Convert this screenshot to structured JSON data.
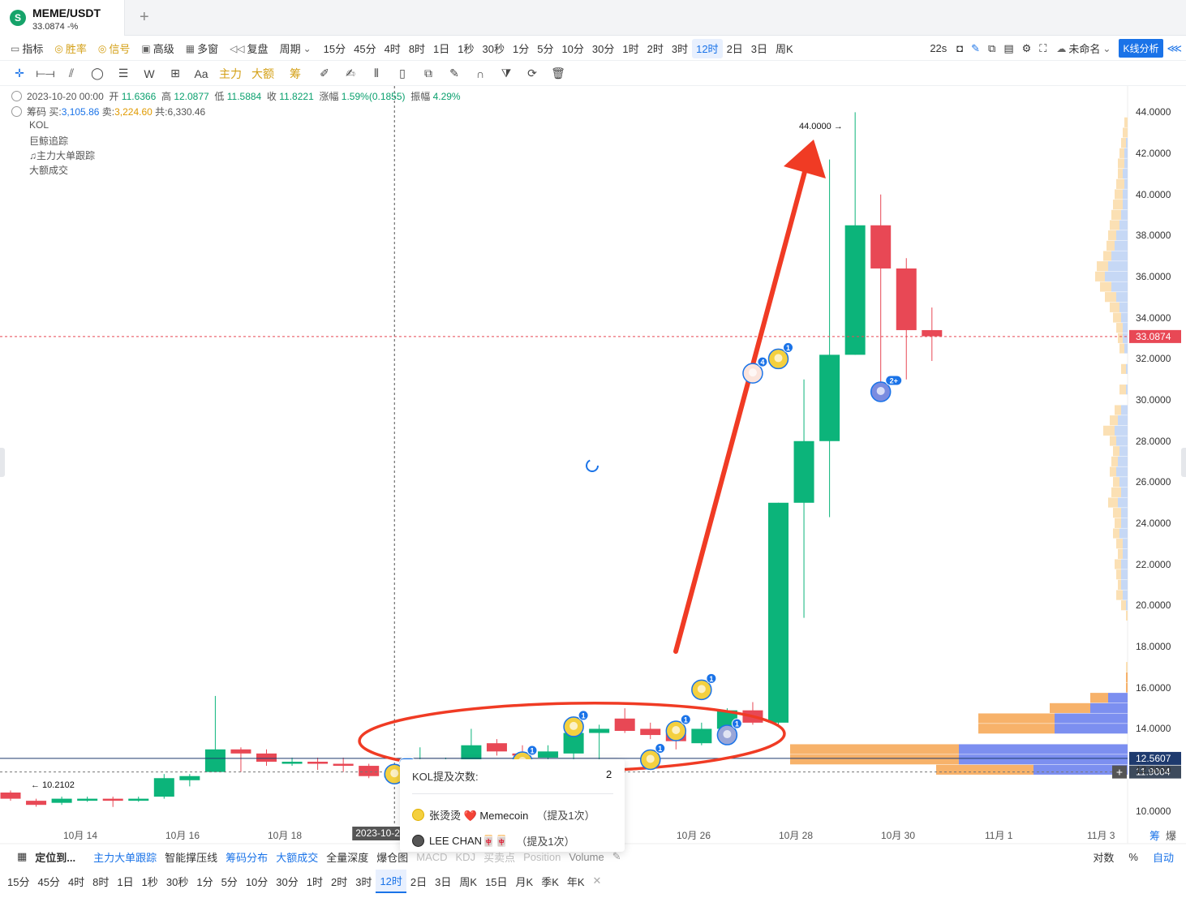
{
  "tab": {
    "title": "MEME/USDT",
    "subtitle": "33.0874  -%",
    "logo": "S"
  },
  "toolbar1": {
    "left": [
      {
        "label": "指标",
        "icon": "indicator-icon"
      },
      {
        "label": "胜率",
        "icon": "winrate-icon",
        "gold": true
      },
      {
        "label": "信号",
        "icon": "signal-icon",
        "gold": true
      },
      {
        "label": "高级",
        "icon": "advanced-icon"
      },
      {
        "label": "多窗",
        "icon": "multiwindow-icon"
      },
      {
        "label": "复盘",
        "icon": "replay-icon"
      },
      {
        "label": "周期",
        "icon": "chevron-down-icon"
      }
    ],
    "periods": [
      "15分",
      "45分",
      "4时",
      "8时",
      "1日",
      "1秒",
      "30秒",
      "1分",
      "5分",
      "10分",
      "30分",
      "1时",
      "2时",
      "3时",
      "12时",
      "2日",
      "3日",
      "周K"
    ],
    "active_period": "12时",
    "countdown": "22s",
    "layout_name": "未命名",
    "analysis_button": "K线分析"
  },
  "toolbar2": {
    "tools": [
      "crosshair-icon",
      "horizontal-line-icon",
      "trend-line-icon",
      "circle-icon",
      "parallel-lines-icon",
      "wave-icon",
      "box-icon",
      "text-icon"
    ],
    "text_tool": "Aa",
    "labels": [
      "主力",
      "大额",
      "筹"
    ],
    "tools_right": [
      "pen-icon",
      "brush-icon",
      "pattern-icon",
      "ruler-icon",
      "copy-icon",
      "note-icon",
      "magnet-icon",
      "filter-icon",
      "sync-icon",
      "trash-icon"
    ]
  },
  "info": {
    "date": "2023-10-20 00:00",
    "open_label": "开",
    "open": "11.6366",
    "high_label": "高",
    "high": "12.0877",
    "low_label": "低",
    "low": "11.5884",
    "close_label": "收",
    "close": "11.8221",
    "change_label": "涨幅",
    "change": "1.59%(0.1855)",
    "amplitude_label": "振幅",
    "amplitude": "4.29%",
    "chip_label": "筹码",
    "buy_label": "买:",
    "buy": "3,105.86",
    "sell_label": "卖:",
    "sell": "3,224.60",
    "total_label": "共:",
    "total": "6,330.46"
  },
  "indicators": [
    "KOL",
    "巨鲸追踪",
    "主力大单跟踪",
    "大额成交"
  ],
  "chart_data": {
    "type": "candlestick",
    "pair": "MEME/USDT",
    "interval": "12时",
    "ylim": [
      9.4,
      45.2
    ],
    "y_ticks": [
      "44.0000",
      "42.0000",
      "40.0000",
      "38.0000",
      "36.0000",
      "34.0000",
      "32.0000",
      "30.0000",
      "28.0000",
      "26.0000",
      "24.0000",
      "22.0000",
      "20.0000",
      "18.0000",
      "16.0000",
      "14.0000",
      "12.0000",
      "10.0000"
    ],
    "x_ticks": [
      "10月 14",
      "10月 16",
      "10月 18",
      "10月 26",
      "10月 28",
      "10月 30",
      "11月 1",
      "11月 3"
    ],
    "crosshair_date": "2023-10-20",
    "price_tags": [
      {
        "value": "33.0874",
        "color": "#e84855"
      },
      {
        "value": "12.5607",
        "color": "#1e3a6e"
      },
      {
        "value": "11.9004",
        "color": "#3d4a5c"
      }
    ],
    "max_label": "44.0000 →",
    "min_label": "← 10.2102",
    "candles": [
      [
        10.9,
        10.6,
        11.0,
        10.5
      ],
      [
        10.5,
        10.3,
        10.6,
        10.2102
      ],
      [
        10.4,
        10.6,
        10.7,
        10.3
      ],
      [
        10.5,
        10.6,
        10.7,
        10.45
      ],
      [
        10.6,
        10.5,
        10.7,
        10.2
      ],
      [
        10.5,
        10.6,
        10.7,
        10.45
      ],
      [
        10.7,
        11.6,
        11.8,
        10.6
      ],
      [
        11.5,
        11.7,
        11.8,
        11.2
      ],
      [
        11.9,
        13.0,
        15.6,
        11.9
      ],
      [
        13.0,
        12.8,
        13.1,
        11.9
      ],
      [
        12.8,
        12.4,
        13.0,
        12.2
      ],
      [
        12.3,
        12.4,
        12.6,
        12.2
      ],
      [
        12.4,
        12.3,
        12.6,
        12.0
      ],
      [
        12.3,
        12.2,
        12.6,
        11.9
      ],
      [
        12.2,
        11.7,
        12.3,
        11.6
      ],
      [
        11.6366,
        11.8221,
        12.0877,
        11.5884
      ],
      [
        11.8,
        12.2,
        13.1,
        11.8
      ],
      [
        12.2,
        12.4,
        12.6,
        12.0
      ],
      [
        12.4,
        13.2,
        14.0,
        12.3
      ],
      [
        13.3,
        12.9,
        13.5,
        12.7
      ],
      [
        12.8,
        12.7,
        13.2,
        12.5
      ],
      [
        12.6,
        12.9,
        13.2,
        12.4
      ],
      [
        12.8,
        13.8,
        14.3,
        12.4
      ],
      [
        13.8,
        14.0,
        14.2,
        11.9
      ],
      [
        14.5,
        13.9,
        15.0,
        13.8
      ],
      [
        14.0,
        13.7,
        14.3,
        13.5
      ],
      [
        13.8,
        13.4,
        14.1,
        13.0
      ],
      [
        13.3,
        14.0,
        14.3,
        13.2
      ],
      [
        14.0,
        14.9,
        15.0,
        13.6
      ],
      [
        14.9,
        14.3,
        15.3,
        14.2
      ],
      [
        14.3,
        25.0,
        25.0,
        14.1
      ],
      [
        25.0,
        28.0,
        31.0,
        19.4
      ],
      [
        28.0,
        32.2,
        41.7,
        24.3
      ],
      [
        32.2,
        38.5,
        44.0,
        32.2
      ],
      [
        38.5,
        36.4,
        40.0,
        30.8
      ],
      [
        36.4,
        33.4,
        36.9,
        31.0
      ],
      [
        33.4,
        33.1,
        34.5,
        31.9
      ]
    ],
    "kol_markers": [
      {
        "candle": 15,
        "price": 11.8,
        "badge": "2+"
      },
      {
        "candle": 20,
        "price": 12.4,
        "badge": "1"
      },
      {
        "candle": 22,
        "price": 14.1,
        "badge": "1"
      },
      {
        "candle": 25,
        "price": 12.5,
        "badge": "1"
      },
      {
        "candle": 26,
        "price": 13.9,
        "badge": "1"
      },
      {
        "candle": 27,
        "price": 15.9,
        "badge": "1"
      },
      {
        "candle": 28,
        "price": 13.7,
        "badge": "1"
      },
      {
        "candle": 29,
        "price": 31.3,
        "badge": "4"
      },
      {
        "candle": 30,
        "price": 32.0,
        "badge": "1"
      },
      {
        "candle": 34,
        "price": 30.4,
        "badge": "2+"
      }
    ]
  },
  "popup": {
    "title": "KOL提及次数:",
    "count": "2",
    "rows": [
      {
        "name": "张烫烫 ❤️ Memecoin",
        "mentions": "（提及1次）"
      },
      {
        "name": "LEE CHAN🀄🀄",
        "mentions": "（提及1次）"
      }
    ]
  },
  "side_labels": {
    "chips": "筹",
    "explode": "爆"
  },
  "bottom1": {
    "locate": "定位到...",
    "items": [
      "主力大单跟踪",
      "智能撑压线",
      "筹码分布",
      "大额成交",
      "全量深度",
      "爆仓图"
    ],
    "hidden_items": [
      "MACD",
      "KDJ",
      "买卖点"
    ],
    "position_label": "Position",
    "volume_label": "Volume",
    "right": [
      "对数",
      "%",
      "自动"
    ]
  },
  "bottom2": {
    "periods": [
      "15分",
      "45分",
      "4时",
      "8时",
      "1日",
      "1秒",
      "30秒",
      "1分",
      "5分",
      "10分",
      "30分",
      "1时",
      "2时",
      "3时",
      "12时",
      "2日",
      "3日",
      "周K",
      "15日",
      "月K",
      "季K",
      "年K"
    ],
    "active": "12时",
    "close": "✕"
  },
  "colors": {
    "up": "#0cb47a",
    "down": "#e84855",
    "accent": "#1a73e8",
    "annotation": "#f03b24"
  }
}
